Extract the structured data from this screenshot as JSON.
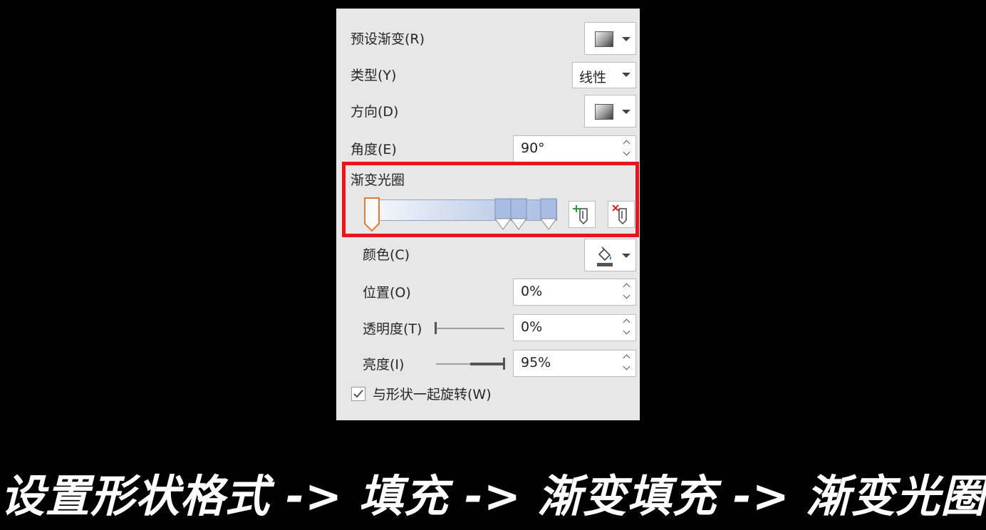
{
  "panel": {
    "preset_gradient_label": "预设渐变(R)",
    "type_label": "类型(Y)",
    "type_value": "线性",
    "direction_label": "方向(D)",
    "angle_label": "角度(E)",
    "angle_value": "90°",
    "gradient_stops_label": "渐变光圈",
    "color_label": "颜色(C)",
    "position_label": "位置(O)",
    "position_value": "0%",
    "transparency_label": "透明度(T)",
    "transparency_value": "0%",
    "brightness_label": "亮度(I)",
    "brightness_value": "95%",
    "rotate_with_shape_label": "与形状一起旋转(W)",
    "rotate_with_shape_checked": true
  },
  "gradient_stops": [
    0,
    70,
    78,
    95
  ],
  "colors": {
    "highlight_border": "#e8141b",
    "gradient_start": "#f8f9fc",
    "gradient_end": "#a9bde4",
    "selected_stop": "#e07a36"
  },
  "caption": "设置形状格式 -> 填充 -> 渐变填充 -> 渐变光圈"
}
